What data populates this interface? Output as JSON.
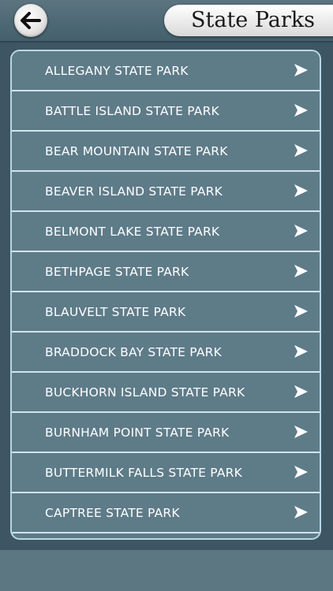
{
  "header": {
    "back_icon": "left-arrow-icon",
    "title": "State Parks"
  },
  "list": {
    "chevron_icon": "right-arrow-icon",
    "items": [
      {
        "label": "ALLEGANY STATE PARK"
      },
      {
        "label": "BATTLE ISLAND STATE PARK"
      },
      {
        "label": "BEAR MOUNTAIN STATE PARK"
      },
      {
        "label": "BEAVER ISLAND STATE PARK"
      },
      {
        "label": "BELMONT LAKE STATE PARK"
      },
      {
        "label": "BETHPAGE STATE PARK"
      },
      {
        "label": "BLAUVELT STATE PARK"
      },
      {
        "label": "BRADDOCK BAY STATE PARK"
      },
      {
        "label": "BUCKHORN ISLAND STATE PARK"
      },
      {
        "label": "BURNHAM POINT STATE PARK"
      },
      {
        "label": "BUTTERMILK FALLS STATE PARK"
      },
      {
        "label": "CAPTREE STATE PARK"
      }
    ]
  },
  "colors": {
    "background": "#3e5663",
    "row": "#5e7b88",
    "row_divider": "#d2e4ec",
    "panel_border": "#b8d8e8",
    "text": "#ffffff"
  }
}
